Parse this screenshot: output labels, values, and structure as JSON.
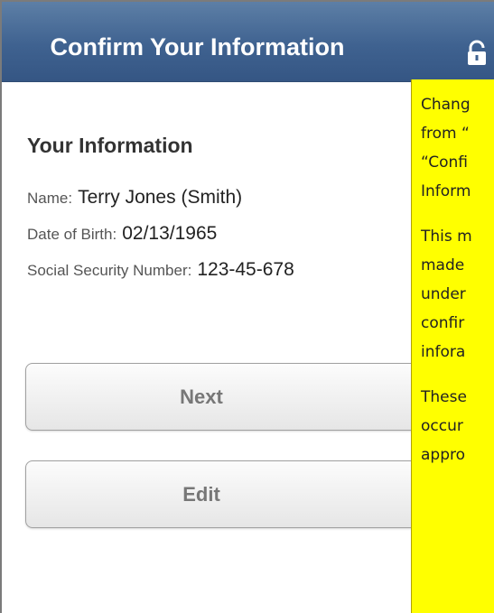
{
  "header": {
    "title": "Confirm Your Information",
    "icon": "lock-icon"
  },
  "info": {
    "heading": "Your Information",
    "name_label": "Name:",
    "name_value": "Terry Jones (Smith)",
    "dob_label": "Date of Birth:",
    "dob_value": "02/13/1965",
    "ssn_label": "Social Security Number:",
    "ssn_value": "123-45-678"
  },
  "buttons": {
    "next": "Next",
    "edit": "Edit"
  },
  "note": {
    "p1": [
      "Chang",
      "from “",
      "“Confi",
      "Inform"
    ],
    "p2": [
      "This m",
      "made",
      "under",
      "confir",
      "infora"
    ],
    "p3": [
      "These",
      "occur",
      "appro"
    ]
  },
  "colors": {
    "header": "#3f6290",
    "note": "#ffff00"
  }
}
